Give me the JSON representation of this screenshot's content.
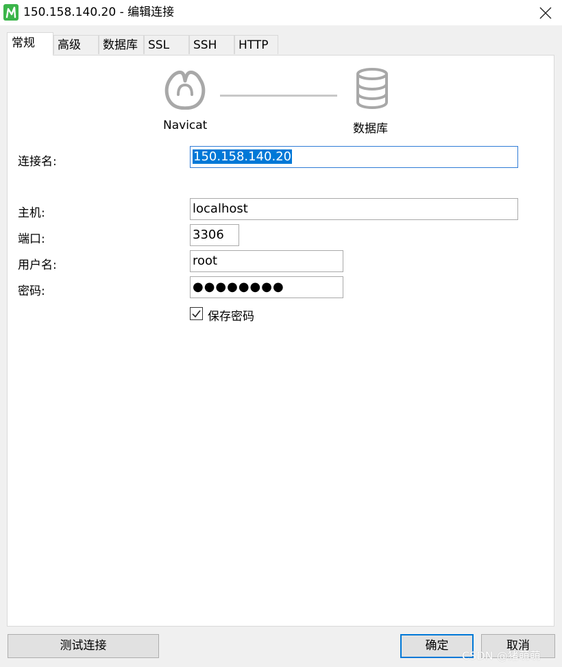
{
  "window": {
    "title": "150.158.140.20 - 编辑连接",
    "app_icon": "navicat-icon",
    "close_icon": "close-icon",
    "brand_color": "#3bb54a"
  },
  "tabs": [
    {
      "label": "常规",
      "active": true
    },
    {
      "label": "高级"
    },
    {
      "label": "数据库"
    },
    {
      "label": "SSL"
    },
    {
      "label": "SSH"
    },
    {
      "label": "HTTP"
    }
  ],
  "diagram": {
    "left_label": "Navicat",
    "right_label": "数据库",
    "left_icon": "navicat-logo-icon",
    "right_icon": "database-icon"
  },
  "form": {
    "connection_name_label": "连接名:",
    "connection_name_value": "150.158.140.20",
    "host_label": "主机:",
    "host_value": "localhost",
    "port_label": "端口:",
    "port_value": "3306",
    "username_label": "用户名:",
    "username_value": "root",
    "password_label": "密码:",
    "password_masked": "●●●●●●●●",
    "save_password_label": "保存密码",
    "save_password_checked": true
  },
  "buttons": {
    "test_connection": "测试连接",
    "ok": "确定",
    "cancel": "取消"
  },
  "watermark": "CSDN @猪萌萌",
  "colors": {
    "selection": "#0078d7",
    "focus_border": "#2e7bd6",
    "icon_gray": "#a8a8a8"
  }
}
